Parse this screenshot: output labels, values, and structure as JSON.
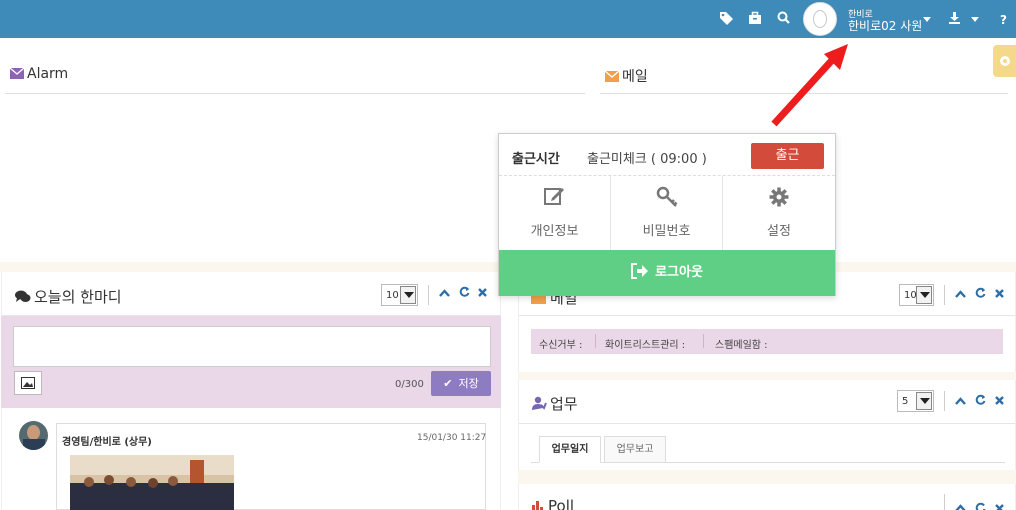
{
  "topbar": {
    "icons": [
      "tag-icon",
      "briefcase-icon",
      "search-icon",
      "download-icon",
      "help-icon"
    ],
    "user_small": "한비로",
    "user_name": "한비로02 사원",
    "help": "?"
  },
  "alarm": {
    "title": "Alarm"
  },
  "mail_top": {
    "title": "메일"
  },
  "popup": {
    "label": "출근시간",
    "status": "출근미체크 ( 09:00 )",
    "checkin_button": "출근",
    "items": [
      "개인정보",
      "비밀번호",
      "설정"
    ],
    "logout": "로그아웃"
  },
  "today": {
    "title": "오늘의 한마디",
    "select": "10",
    "counter": "0/300",
    "save_button": "저장",
    "post": {
      "author": "경영팀/한비로 (상무)",
      "time": "15/01/30 11:27"
    }
  },
  "mail_widget": {
    "title": "메일",
    "select": "10",
    "filters": [
      "수신거부 :",
      "화이트리스트관리 :",
      "스팸메일함 :"
    ]
  },
  "work_widget": {
    "title": "업무",
    "select": "5",
    "tabs": [
      "업무일지",
      "업무보고"
    ]
  },
  "poll_widget": {
    "title": "Poll"
  },
  "colors": {
    "topbar": "#3e8ab9",
    "checkin": "#d24b3b",
    "logout": "#5fcf85",
    "save": "#8e7cc3",
    "pink": "#ead7e8",
    "annotation_arrow": "#ee1c1c"
  }
}
